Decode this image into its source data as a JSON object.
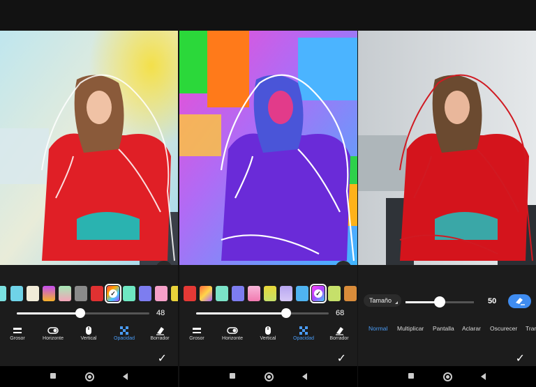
{
  "panel1": {
    "opacity_value": "48",
    "opacity_fraction": 0.48,
    "tools": [
      {
        "label": "Grosor",
        "icon": "thickness-icon",
        "active": false
      },
      {
        "label": "Horizonte",
        "icon": "toggle-icon",
        "active": false
      },
      {
        "label": "Vertical",
        "icon": "mouse-icon",
        "active": false
      },
      {
        "label": "Opacidad",
        "icon": "opacity-icon",
        "active": true
      },
      {
        "label": "Borrador",
        "icon": "eraser-icon",
        "active": false
      }
    ],
    "swatches": [
      "#6fd3e8",
      "#f1ecd8",
      "gradient-pink-yellow",
      "gradient-green-pink",
      "#8a8a8a",
      "#e03131",
      "gradient-rainbow",
      "#6ee7c2",
      "#7d7df0",
      "#f5a0c8",
      "#e9d23a"
    ],
    "selected_swatch": 6
  },
  "panel2": {
    "opacity_value": "68",
    "opacity_fraction": 0.68,
    "tools": [
      {
        "label": "Grosor",
        "icon": "thickness-icon",
        "active": false
      },
      {
        "label": "Horizonte",
        "icon": "toggle-icon",
        "active": false
      },
      {
        "label": "Vertical",
        "icon": "mouse-icon",
        "active": false
      },
      {
        "label": "Opacidad",
        "icon": "opacity-icon",
        "active": true
      },
      {
        "label": "Borrador",
        "icon": "eraser-icon",
        "active": false
      }
    ],
    "swatches": [
      "#e53935",
      "gradient-rainbow",
      "#7be3c8",
      "#7d7df0",
      "gradient-pink",
      "gradient-yellow",
      "gradient-lavender",
      "#4fb3f0",
      "gradient-sel",
      "#c6e06a",
      "#d98c3a"
    ],
    "selected_swatch": 8
  },
  "panel3": {
    "size_label": "Tamaño",
    "size_value": "50",
    "size_fraction": 0.5,
    "blend_modes": [
      {
        "label": "Normal",
        "active": true
      },
      {
        "label": "Multiplicar",
        "active": false
      },
      {
        "label": "Pantalla",
        "active": false
      },
      {
        "label": "Aclarar",
        "active": false
      },
      {
        "label": "Oscurecer",
        "active": false
      },
      {
        "label": "Tran",
        "active": false
      }
    ]
  },
  "accent_color": "#4a9cf6",
  "confirm_icon": "checkmark-icon"
}
